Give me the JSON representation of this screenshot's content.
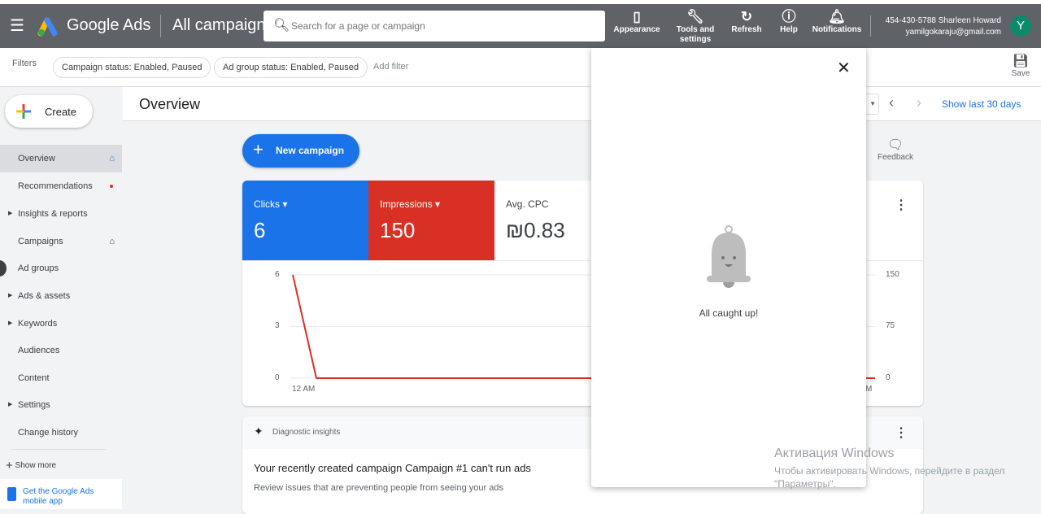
{
  "header": {
    "app_name": "Google Ads",
    "page_title": "All campaigns",
    "search_placeholder": "Search for a page or campaign",
    "tools": [
      {
        "label": "Appearance",
        "icon": "appearance-icon"
      },
      {
        "label": "Tools and settings",
        "icon": "wrench-icon"
      },
      {
        "label": "Refresh",
        "icon": "refresh-icon"
      },
      {
        "label": "Help",
        "icon": "help-icon"
      },
      {
        "label": "Notifications",
        "icon": "bell-icon"
      }
    ],
    "account_line": "454-430-5788 Sharleen Howard",
    "email": "yamilgokaraju@gmail.com",
    "avatar_letter": "Y"
  },
  "filters": {
    "label": "Filters",
    "chips": [
      "Campaign status: Enabled, Paused",
      "Ad group status: Enabled, Paused"
    ],
    "add_filter": "Add filter",
    "save": "Save"
  },
  "sidebar": {
    "create": "Create",
    "items": [
      {
        "label": "Overview"
      },
      {
        "label": "Recommendations"
      },
      {
        "label": "Insights & reports"
      },
      {
        "label": "Campaigns"
      },
      {
        "label": "Ad groups"
      },
      {
        "label": "Ads & assets"
      },
      {
        "label": "Keywords"
      },
      {
        "label": "Audiences"
      },
      {
        "label": "Content"
      },
      {
        "label": "Settings"
      },
      {
        "label": "Change history"
      }
    ],
    "show_more": "Show more",
    "mobile_app": "Get the Google Ads mobile app"
  },
  "main": {
    "title": "Overview",
    "show_last": "Show last 30 days",
    "new_campaign": "New campaign",
    "feedback": "Feedback",
    "metrics": [
      {
        "label": "Clicks",
        "value": "6",
        "color": "#1a73e8"
      },
      {
        "label": "Impressions",
        "value": "150",
        "color": "#d93025"
      },
      {
        "label": "Avg. CPC",
        "value": "₪0.83"
      }
    ],
    "diagnostic": {
      "header": "Diagnostic insights",
      "title": "Your recently created campaign Campaign #1 can't run ads",
      "body": "Review issues that are preventing people from seeing your ads"
    }
  },
  "chart_data": {
    "type": "line",
    "left_ticks": [
      "6",
      "3",
      "0"
    ],
    "right_ticks": [
      "150",
      "75",
      "0"
    ],
    "x_labels": [
      "12 AM",
      "M"
    ],
    "series": [
      {
        "name": "Impressions",
        "values": [
          150,
          0,
          0,
          0
        ]
      }
    ],
    "ylim_left": [
      0,
      6
    ],
    "ylim_right": [
      0,
      150
    ]
  },
  "notifications": {
    "message": "All caught up!"
  },
  "watermark": {
    "title": "Активация Windows",
    "subtitle": "Чтобы активировать Windows, перейдите в раздел \"Параметры\"."
  }
}
